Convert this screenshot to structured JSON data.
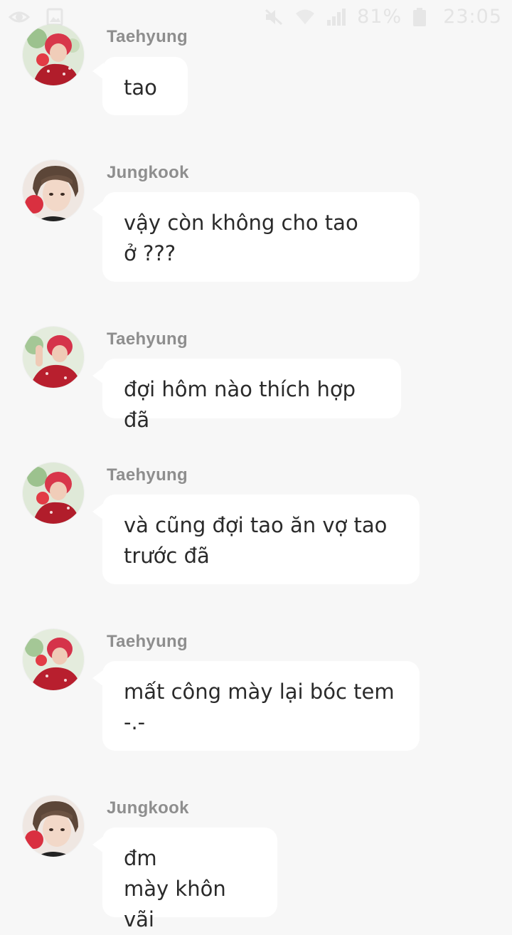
{
  "status_bar": {
    "battery_text": "81%",
    "time": "23:05",
    "icons": [
      "eye-icon",
      "image-icon",
      "mute-icon",
      "wifi-icon",
      "signal-icon",
      "battery-icon"
    ]
  },
  "messages": [
    {
      "sender": "Taehyung",
      "text": "tao",
      "avatar": "taehyung-avatar"
    },
    {
      "sender": "Jungkook",
      "text": "vậy còn không cho tao\nở ???",
      "avatar": "jungkook-avatar"
    },
    {
      "sender": "Taehyung",
      "text": "đợi hôm nào thích hợp đã",
      "avatar": "taehyung-avatar"
    },
    {
      "sender": "Taehyung",
      "text": "và cũng đợi tao ăn vợ tao\ntrước đã",
      "avatar": "taehyung-avatar"
    },
    {
      "sender": "Taehyung",
      "text": "mất công mày lại bóc tem\n-.-",
      "avatar": "taehyung-avatar"
    },
    {
      "sender": "Jungkook",
      "text": "đm\nmày khôn vãi",
      "avatar": "jungkook-avatar"
    }
  ],
  "colors": {
    "background": "#f7f7f7",
    "bubble": "#ffffff",
    "sender": "#8e8e8e",
    "text": "#2a2a2a"
  }
}
